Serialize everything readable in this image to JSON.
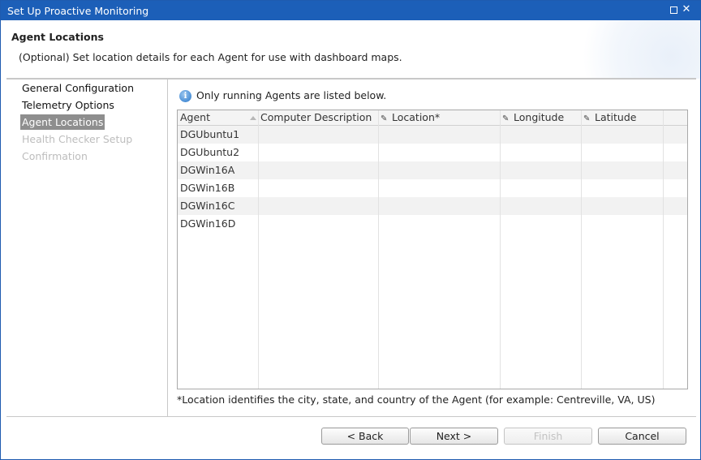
{
  "window": {
    "title": "Set Up Proactive Monitoring",
    "maximize_icon": "maximize-icon",
    "close_icon": "close-icon",
    "close_glyph": "✕"
  },
  "header": {
    "heading": "Agent Locations",
    "subheading": "(Optional) Set location details for each Agent for use with dashboard maps."
  },
  "sidebar": {
    "steps": [
      {
        "label": "General Configuration",
        "state": "normal"
      },
      {
        "label": "Telemetry Options",
        "state": "normal"
      },
      {
        "label": "Agent Locations",
        "state": "active"
      },
      {
        "label": "Health Checker Setup",
        "state": "disabled"
      },
      {
        "label": "Confirmation",
        "state": "disabled"
      }
    ]
  },
  "info": {
    "icon": "info-icon",
    "glyph": "i",
    "message": "Only running Agents are listed below."
  },
  "grid": {
    "columns": [
      {
        "label": "Agent",
        "editable": false,
        "sorted": "ascending"
      },
      {
        "label": "Computer Description",
        "editable": false
      },
      {
        "label": "Location*",
        "editable": true
      },
      {
        "label": "Longitude",
        "editable": true
      },
      {
        "label": "Latitude",
        "editable": true
      }
    ],
    "edit_glyph": "✎",
    "rows": [
      {
        "agent": "DGUbuntu1",
        "description": "",
        "location": "",
        "longitude": "",
        "latitude": ""
      },
      {
        "agent": "DGUbuntu2",
        "description": "",
        "location": "",
        "longitude": "",
        "latitude": ""
      },
      {
        "agent": "DGWin16A",
        "description": "",
        "location": "",
        "longitude": "",
        "latitude": ""
      },
      {
        "agent": "DGWin16B",
        "description": "",
        "location": "",
        "longitude": "",
        "latitude": ""
      },
      {
        "agent": "DGWin16C",
        "description": "",
        "location": "",
        "longitude": "",
        "latitude": ""
      },
      {
        "agent": "DGWin16D",
        "description": "",
        "location": "",
        "longitude": "",
        "latitude": ""
      }
    ]
  },
  "note": "*Location identifies the city, state, and country of the Agent (for example: Centreville, VA, US)",
  "buttons": {
    "back": "< Back",
    "next": "Next >",
    "finish": "Finish",
    "cancel": "Cancel",
    "finish_enabled": false
  },
  "colors": {
    "titlebar": "#1c5fb8",
    "active_step_bg": "#8e8e8e",
    "alt_row_bg": "#f2f2f2"
  }
}
